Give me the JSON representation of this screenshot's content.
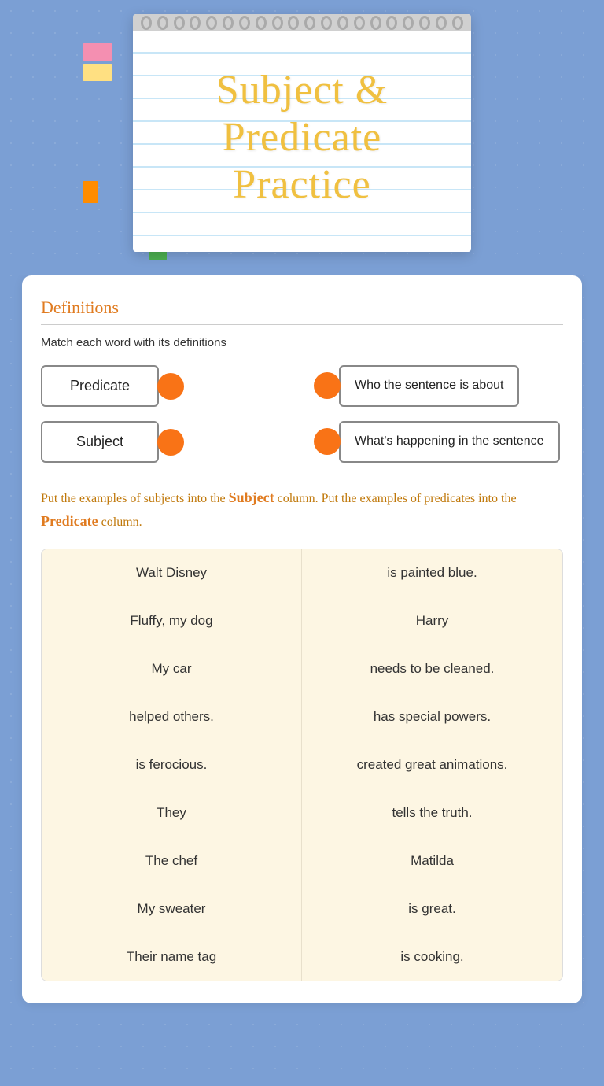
{
  "header": {
    "title_line1": "Subject &",
    "title_line2": "Predicate Practice"
  },
  "definitions": {
    "section_title": "Definitions",
    "instruction": "Match each word with its definitions",
    "items": [
      {
        "term": "Predicate",
        "definition": "What's happening in the sentence"
      },
      {
        "term": "Subject",
        "definition": "Who the sentence is about"
      }
    ]
  },
  "sorting": {
    "instruction_start": "Put the examples of subjects into the ",
    "subject_label": "Subject",
    "instruction_mid": " column. Put the examples of predicates into the ",
    "predicate_label": "Predicate",
    "instruction_end": " column.",
    "rows": [
      {
        "left": "Walt Disney",
        "right": "is painted blue."
      },
      {
        "left": "Fluffy, my dog",
        "right": "Harry"
      },
      {
        "left": "My car",
        "right": "needs to be cleaned."
      },
      {
        "left": "helped others.",
        "right": "has special powers."
      },
      {
        "left": "is ferocious.",
        "right": "created great animations."
      },
      {
        "left": "They",
        "right": "tells the truth."
      },
      {
        "left": "The chef",
        "right": "Matilda"
      },
      {
        "left": "My sweater",
        "right": "is great."
      },
      {
        "left": "Their name tag",
        "right": "is cooking."
      }
    ]
  }
}
